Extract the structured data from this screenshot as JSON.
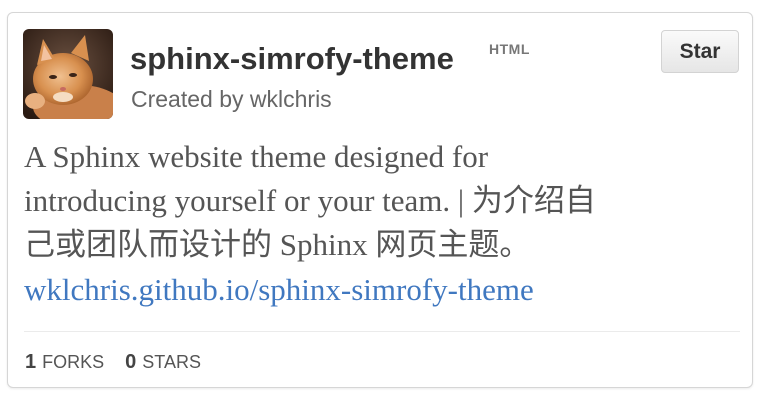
{
  "repo": {
    "name": "sphinx-simrofy-theme",
    "language": "HTML",
    "creator_text": "Created by wklchris",
    "description_line1": "A Sphinx website theme designed for",
    "description_line2": "introducing yourself or your team. | 为介绍自",
    "description_line3": "己或团队而设计的 Sphinx 网页主题。",
    "homepage": "wklchris.github.io/sphinx-simrofy-theme",
    "avatar_icon": "kitten-avatar-icon"
  },
  "buttons": {
    "star_label": "Star"
  },
  "stats": {
    "forks_count": "1",
    "forks_label": "FORKS",
    "stars_count": "0",
    "stars_label": "STARS"
  },
  "colors": {
    "link": "#4078c0",
    "title": "#333333",
    "muted": "#666666",
    "border": "#d6d6d6"
  }
}
